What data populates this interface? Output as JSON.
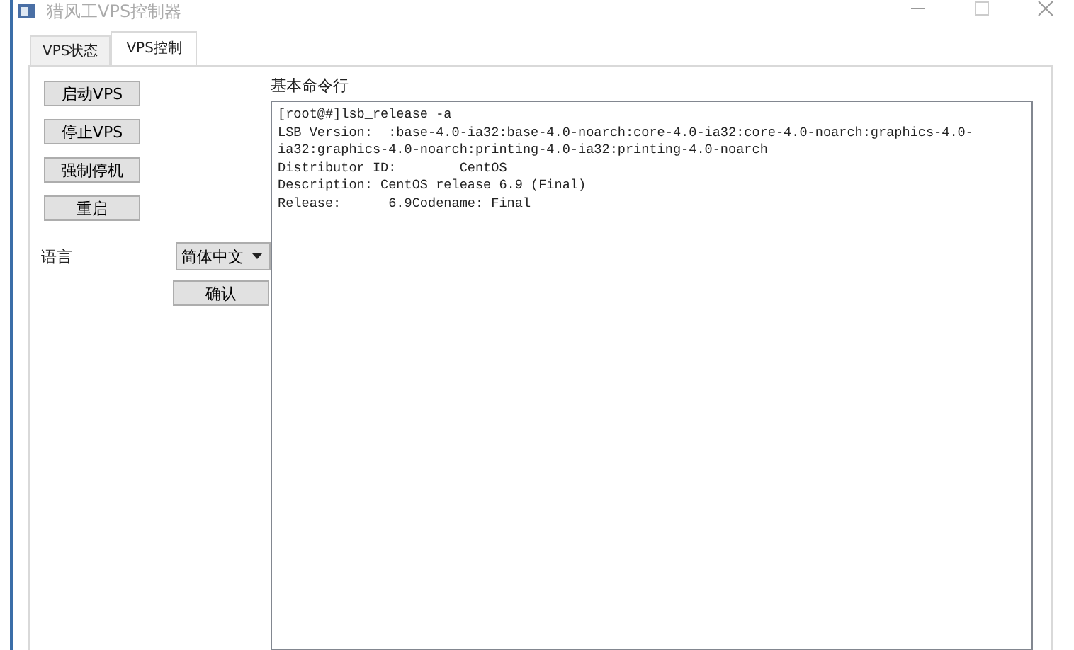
{
  "window": {
    "title": "猎风工VPS控制器"
  },
  "tabs": [
    {
      "label": "VPS状态",
      "selected": false
    },
    {
      "label": "VPS控制",
      "selected": true
    }
  ],
  "buttons": [
    "启动VPS",
    "停止VPS",
    "强制停机",
    "重启"
  ],
  "language": {
    "label": "语言",
    "value": "简体中文"
  },
  "confirm_button": "确认",
  "console": {
    "label": "基本命令行",
    "lines": [
      "[root@#]lsb_release -a",
      "LSB Version:  :base-4.0-ia32:base-4.0-noarch:core-4.0-ia32:core-4.0-noarch:graphics-4.0-ia32:graphics-4.0-noarch:printing-4.0-ia32:printing-4.0-noarch",
      "Distributor ID:        CentOS",
      "Description: CentOS release 6.9 (Final)",
      "Release:      6.9Codename: Final"
    ]
  }
}
